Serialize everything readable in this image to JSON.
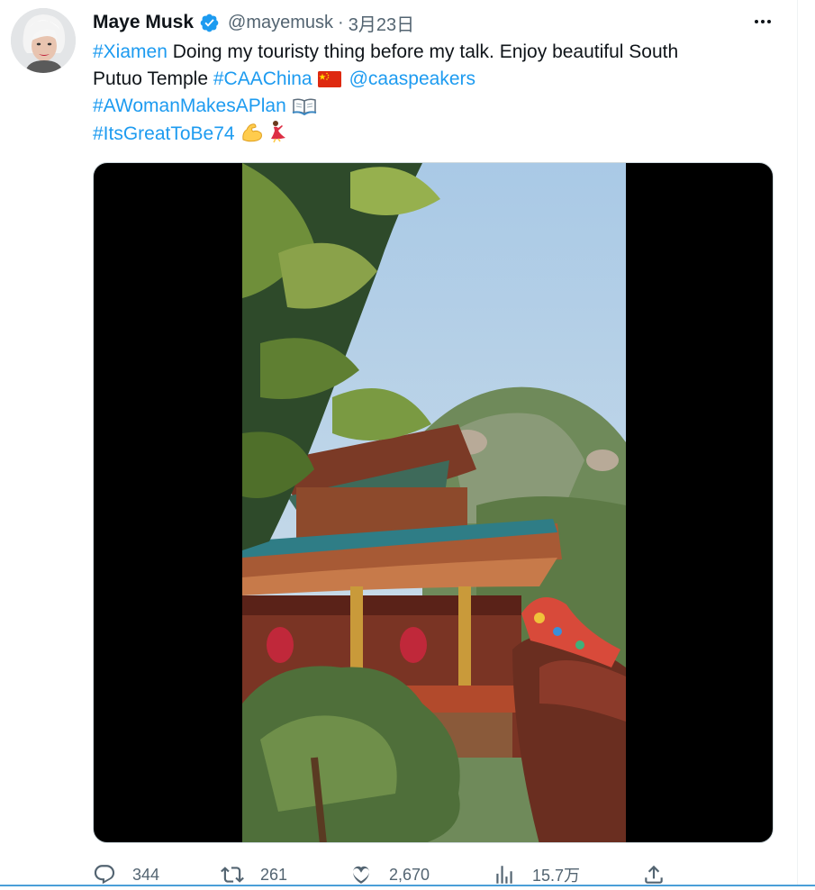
{
  "author": {
    "name": "Maye Musk",
    "handle": "@mayemusk",
    "separator": "·",
    "date": "3月23日",
    "avatar_icon": "profile-photo",
    "verified_icon": "verified-badge-icon"
  },
  "tweet": {
    "line1": {
      "tag": "#Xiamen",
      "text": " Doing my touristy thing before my talk. Enjoy beautiful South"
    },
    "line2": {
      "text": "Putuo Temple ",
      "tag": "#CAAChina",
      "flag": "china-flag-emoji",
      "mention": "@caaspeakers"
    },
    "line3": {
      "tag": "#AWomanMakesAPlan",
      "emoji": "open-book-emoji"
    },
    "line4": {
      "tag": "#ItsGreatToBe74",
      "emoji1": "flexed-biceps-emoji",
      "emoji2": "woman-dancing-emoji"
    }
  },
  "media": {
    "type": "video",
    "description_icon": "temple-video-thumbnail"
  },
  "actions": {
    "reply": {
      "icon": "reply-icon",
      "count": "344"
    },
    "retweet": {
      "icon": "retweet-icon",
      "count": "261"
    },
    "like": {
      "icon": "heart-icon",
      "count": "2,670"
    },
    "views": {
      "icon": "views-icon",
      "count": "15.7万"
    },
    "share": {
      "icon": "share-icon"
    }
  },
  "colors": {
    "link": "#1d9bf0",
    "secondary_text": "#536471",
    "verified": "#1d9bf0"
  }
}
